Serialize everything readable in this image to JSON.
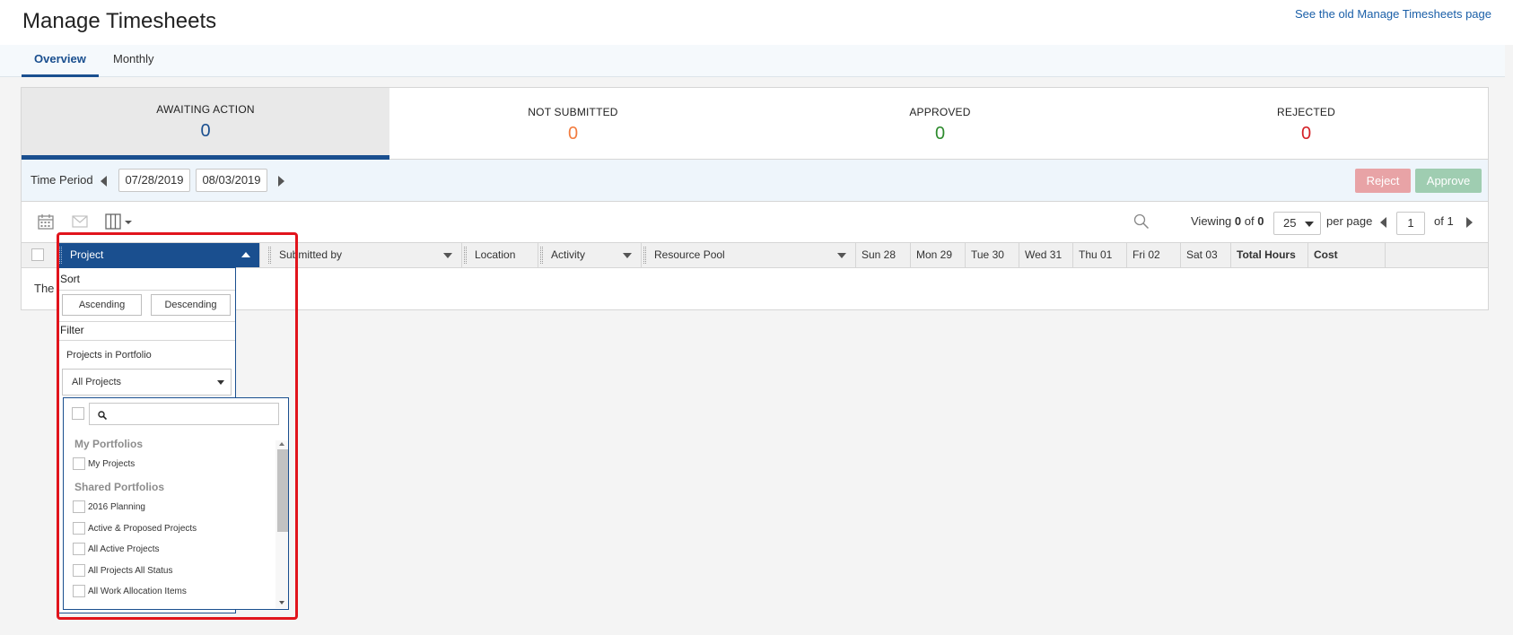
{
  "page": {
    "title": "Manage Timesheets",
    "old_link": "See the old Manage Timesheets page"
  },
  "tabs": [
    {
      "label": "Overview",
      "active": true
    },
    {
      "label": "Monthly",
      "active": false
    }
  ],
  "summary": [
    {
      "label": "AWAITING ACTION",
      "value": "0",
      "color": "#1a4f8f",
      "active": true
    },
    {
      "label": "NOT SUBMITTED",
      "value": "0",
      "color": "#f27c3f"
    },
    {
      "label": "APPROVED",
      "value": "0",
      "color": "#2e8b2e"
    },
    {
      "label": "REJECTED",
      "value": "0",
      "color": "#d42026"
    }
  ],
  "period": {
    "label": "Time Period",
    "start": "07/28/2019",
    "end": "08/03/2019",
    "reject_label": "Reject",
    "approve_label": "Approve"
  },
  "toolbar": {
    "icons": [
      "calendar-icon",
      "envelope-icon",
      "columns-icon"
    ]
  },
  "pagination": {
    "viewing_prefix": "Viewing",
    "viewing_from": "0",
    "viewing_of": "of",
    "viewing_total": "0",
    "per_page_value": "25",
    "per_page_label": "per page",
    "page": "1",
    "of_pages": "of 1"
  },
  "columns": [
    "Project",
    "Submitted by",
    "Location",
    "Activity",
    "Resource Pool",
    "Sun 28",
    "Mon 29",
    "Tue 30",
    "Wed 31",
    "Thu 01",
    "Fri 02",
    "Sat 03",
    "Total Hours",
    "Cost"
  ],
  "grid": {
    "empty_text": "The"
  },
  "dropdown": {
    "sort_label": "Sort",
    "ascending": "Ascending",
    "descending": "Descending",
    "filter_label": "Filter",
    "filter_field_label": "Projects in Portfolio",
    "selected": "All Projects",
    "groups": [
      {
        "title": "My Portfolios",
        "items": [
          "My Projects"
        ]
      },
      {
        "title": "Shared Portfolios",
        "items": [
          "2016 Planning",
          "Active & Proposed Projects",
          "All Active Projects",
          "All Projects All Status",
          "All Work Allocation Items"
        ]
      }
    ]
  },
  "highlight_color": "#e1141c"
}
